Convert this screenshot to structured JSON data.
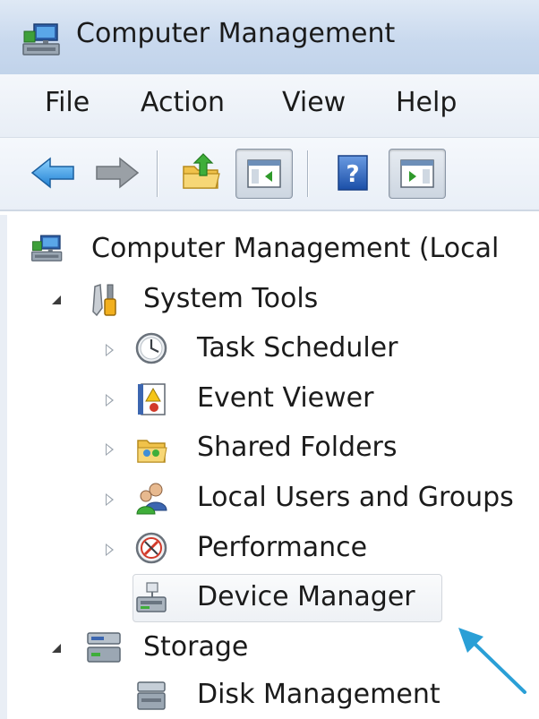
{
  "window": {
    "title": "Computer Management",
    "title_icon": "computer-management-icon"
  },
  "menu": {
    "items": [
      {
        "label": "File"
      },
      {
        "label": "Action"
      },
      {
        "label": "View"
      },
      {
        "label": "Help"
      }
    ]
  },
  "toolbar": {
    "buttons": [
      {
        "name": "back-button",
        "icon": "back-arrow-icon"
      },
      {
        "name": "forward-button",
        "icon": "forward-arrow-icon"
      },
      {
        "name": "up-one-level-button",
        "icon": "up-folder-icon"
      },
      {
        "name": "show-hide-console-tree-button",
        "icon": "console-tree-icon",
        "pressed": true
      },
      {
        "name": "help-button",
        "icon": "help-icon"
      },
      {
        "name": "show-hide-action-pane-button",
        "icon": "action-pane-icon",
        "pressed": true
      }
    ]
  },
  "tree": {
    "root": {
      "label": "Computer Management (Local",
      "icon": "computer-management-icon"
    },
    "system_tools": {
      "label": "System Tools",
      "icon": "tools-icon",
      "expanded": true
    },
    "task_scheduler": {
      "label": "Task Scheduler",
      "icon": "clock-icon"
    },
    "event_viewer": {
      "label": "Event Viewer",
      "icon": "event-log-icon"
    },
    "shared_folders": {
      "label": "Shared Folders",
      "icon": "shared-folder-icon"
    },
    "local_users": {
      "label": "Local Users and Groups",
      "icon": "users-icon"
    },
    "performance": {
      "label": "Performance",
      "icon": "gauge-icon"
    },
    "device_manager": {
      "label": "Device Manager",
      "icon": "device-manager-icon",
      "highlighted": true
    },
    "storage": {
      "label": "Storage",
      "icon": "storage-icon",
      "expanded": true
    },
    "disk_management": {
      "label": "Disk Management",
      "icon": "disk-icon"
    }
  },
  "colors": {
    "callout_arrow": "#2a9fd6",
    "titlebar": "#c9d9ee",
    "text": "#1b1b1b"
  }
}
